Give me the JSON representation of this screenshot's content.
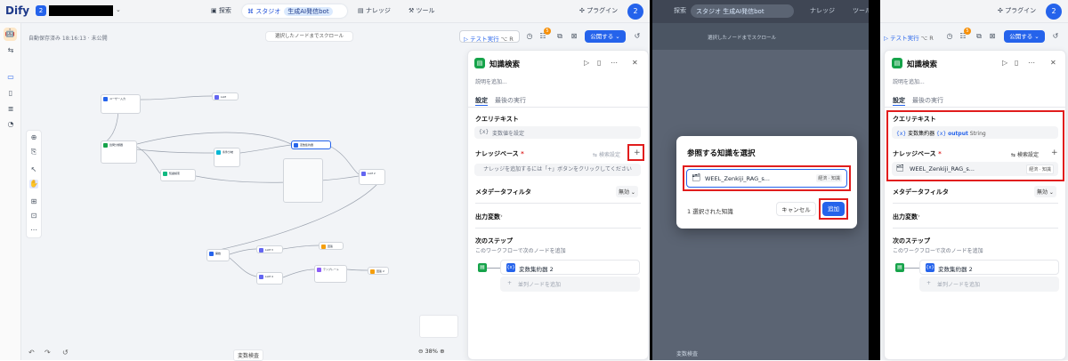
{
  "logo": "Dify",
  "workspace_badge": "2",
  "nav": {
    "explore": "探索",
    "studio": "スタジオ",
    "app": "生成AI発信bot",
    "knowledge": "ナレッジ",
    "tools": "ツール",
    "plugins": "プラグイン",
    "avatar": "2"
  },
  "canvas": {
    "autosave": "自動保存済み 18:16:13 · 未公開",
    "scroll_hint": "選択したノードまでスクロール",
    "test_run": "テスト実行",
    "shortcut": "⌥ R",
    "publish": "公開する",
    "badge": "5",
    "zoom": "38%",
    "var_inspect": "変数検査"
  },
  "panel": {
    "title": "知識検索",
    "desc_placeholder": "説明を追加...",
    "tab_settings": "設定",
    "tab_last_run": "最後の実行",
    "query_label": "クエリテキスト",
    "query_placeholder": "変数値を設定",
    "knowledge_label": "ナレッジベース",
    "required": "*",
    "retrieval_setting": "検索設定",
    "empty_hint": "ナレッジを追加するには「+」ボタンをクリックしてください",
    "metadata_label": "メタデータフィルタ",
    "metadata_value": "無効",
    "output_label": "出力変数",
    "next_label": "次のステップ",
    "next_hint": "このワークフローで次のノードを追加",
    "next_node": "変数集約器 2",
    "add_parallel": "並列ノードを追加"
  },
  "modal": {
    "title": "参照する知識を選択",
    "item_name": "WEEL_Zenkiji_RAG_s...",
    "item_tags": "経済 · 知識",
    "count": "1 選択された知識",
    "cancel": "キャンセル",
    "add": "追加"
  },
  "panel3": {
    "query_var_prefix": "{x}",
    "query_var_node": "変数集約器",
    "query_var_name": "output",
    "query_var_type": "String",
    "kb_item": "WEEL_Zenkiji_RAG_s...",
    "kb_tags": "経済 · 知識"
  },
  "nodes": [
    "ユーザー入力",
    "質問分類器",
    "LLM",
    "知識検索",
    "条件分岐",
    "変数集約器",
    "LLM 2",
    "回答",
    "LLM 3",
    "テンプレート",
    "LLM 4",
    "回答 2",
    "開始"
  ]
}
